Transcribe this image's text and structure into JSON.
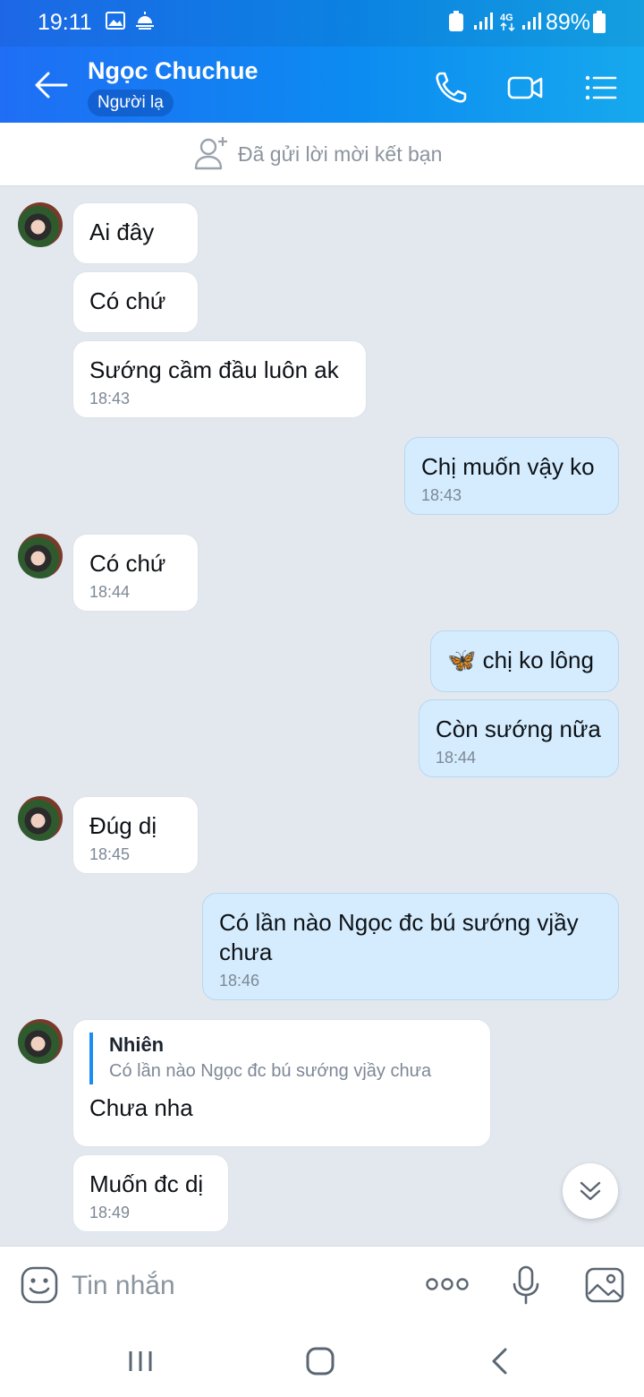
{
  "status": {
    "time": "19:11",
    "battery": "89%"
  },
  "header": {
    "name": "Ngọc Chuchue",
    "badge": "Người lạ"
  },
  "friend_bar": {
    "text": "Đã gửi lời mời kết bạn"
  },
  "messages": {
    "m1": {
      "text": "Ai đây"
    },
    "m2": {
      "text": "Có chứ"
    },
    "m3": {
      "text": "Sướng cầm đầu luôn ak",
      "time": "18:43"
    },
    "m4": {
      "text": "Chị muốn vậy ko",
      "time": "18:43"
    },
    "m5": {
      "text": "Có chứ",
      "time": "18:44"
    },
    "m6": {
      "emoji": "🦋",
      "text": "chị ko lông"
    },
    "m7": {
      "text": "Còn sướng nữa",
      "time": "18:44"
    },
    "m8": {
      "text": "Đúg dị",
      "time": "18:45"
    },
    "m9": {
      "text": "Có lần nào Ngọc đc bú sướng vjầy chưa",
      "time": "18:46"
    },
    "m10": {
      "reply_name": "Nhiên",
      "reply_text": "Có lần nào Ngọc đc bú sướng vjầy chưa",
      "text": "Chưa nha"
    },
    "m11": {
      "text": "Muốn đc dị",
      "time": "18:49"
    }
  },
  "input": {
    "placeholder": "Tin nhắn"
  },
  "icons": {
    "back": "arrow-left-icon",
    "call": "phone-icon",
    "video": "video-camera-icon",
    "menu": "list-menu-icon",
    "sticker": "smiley-icon",
    "more": "more-dots-icon",
    "mic": "microphone-icon",
    "image": "image-icon",
    "scroll": "chevron-double-down-icon"
  },
  "colors": {
    "header_start": "#1f6ef5",
    "header_end": "#16a9ee",
    "outgoing_bubble": "#d4ecfd",
    "chat_bg": "#e3e8ef",
    "reply_accent": "#1a8cf2"
  }
}
